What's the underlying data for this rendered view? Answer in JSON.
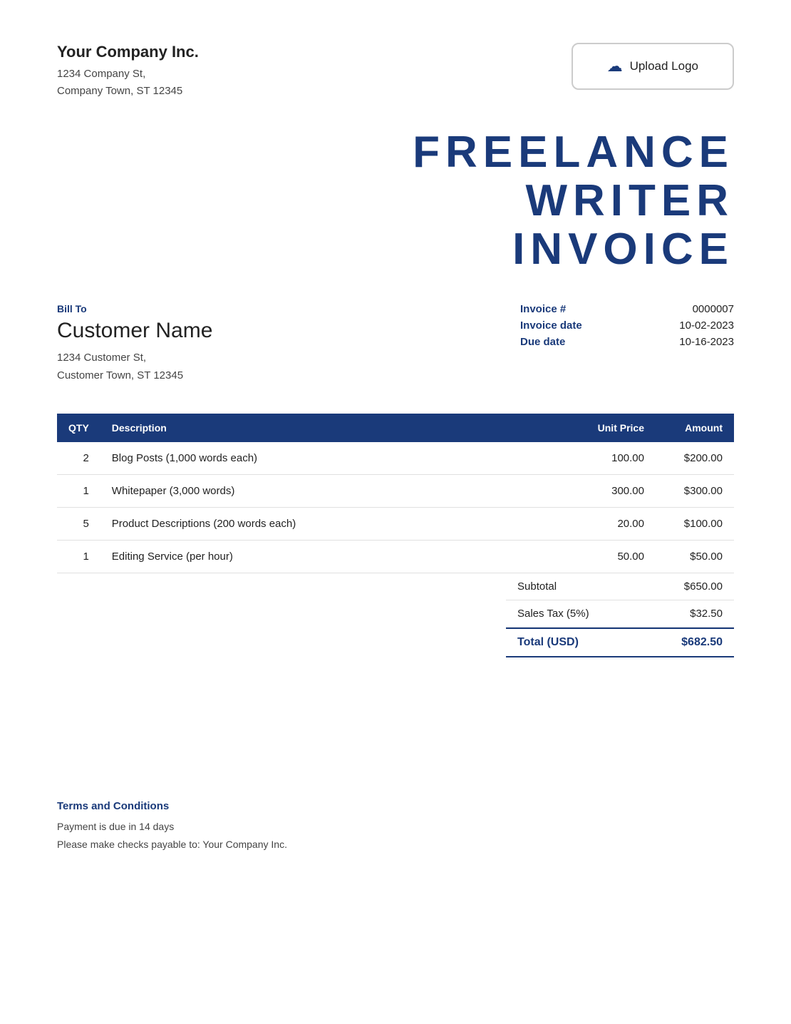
{
  "company": {
    "name": "Your Company Inc.",
    "address_line1": "1234 Company St,",
    "address_line2": "Company Town, ST 12345"
  },
  "upload_logo": {
    "label": "Upload Logo",
    "icon": "☁"
  },
  "invoice_title": {
    "line1": "FREELANCE",
    "line2": "WRITER",
    "line3": "INVOICE"
  },
  "bill_to": {
    "label": "Bill To",
    "customer_name": "Customer Name",
    "address_line1": "1234 Customer St,",
    "address_line2": "Customer Town, ST 12345"
  },
  "invoice_meta": {
    "invoice_number_label": "Invoice #",
    "invoice_number_value": "0000007",
    "invoice_date_label": "Invoice date",
    "invoice_date_value": "10-02-2023",
    "due_date_label": "Due date",
    "due_date_value": "10-16-2023"
  },
  "table": {
    "headers": {
      "qty": "QTY",
      "description": "Description",
      "unit_price": "Unit Price",
      "amount": "Amount"
    },
    "rows": [
      {
        "qty": "2",
        "description": "Blog Posts (1,000 words each)",
        "unit_price": "100.00",
        "amount": "$200.00"
      },
      {
        "qty": "1",
        "description": "Whitepaper (3,000 words)",
        "unit_price": "300.00",
        "amount": "$300.00"
      },
      {
        "qty": "5",
        "description": "Product Descriptions (200 words each)",
        "unit_price": "20.00",
        "amount": "$100.00"
      },
      {
        "qty": "1",
        "description": "Editing Service (per hour)",
        "unit_price": "50.00",
        "amount": "$50.00"
      }
    ]
  },
  "totals": {
    "subtotal_label": "Subtotal",
    "subtotal_value": "$650.00",
    "tax_label": "Sales Tax (5%)",
    "tax_value": "$32.50",
    "total_label": "Total (USD)",
    "total_value": "$682.50"
  },
  "terms": {
    "title": "Terms and Conditions",
    "line1": "Payment is due in 14 days",
    "line2": "Please make checks payable to: Your Company Inc."
  }
}
